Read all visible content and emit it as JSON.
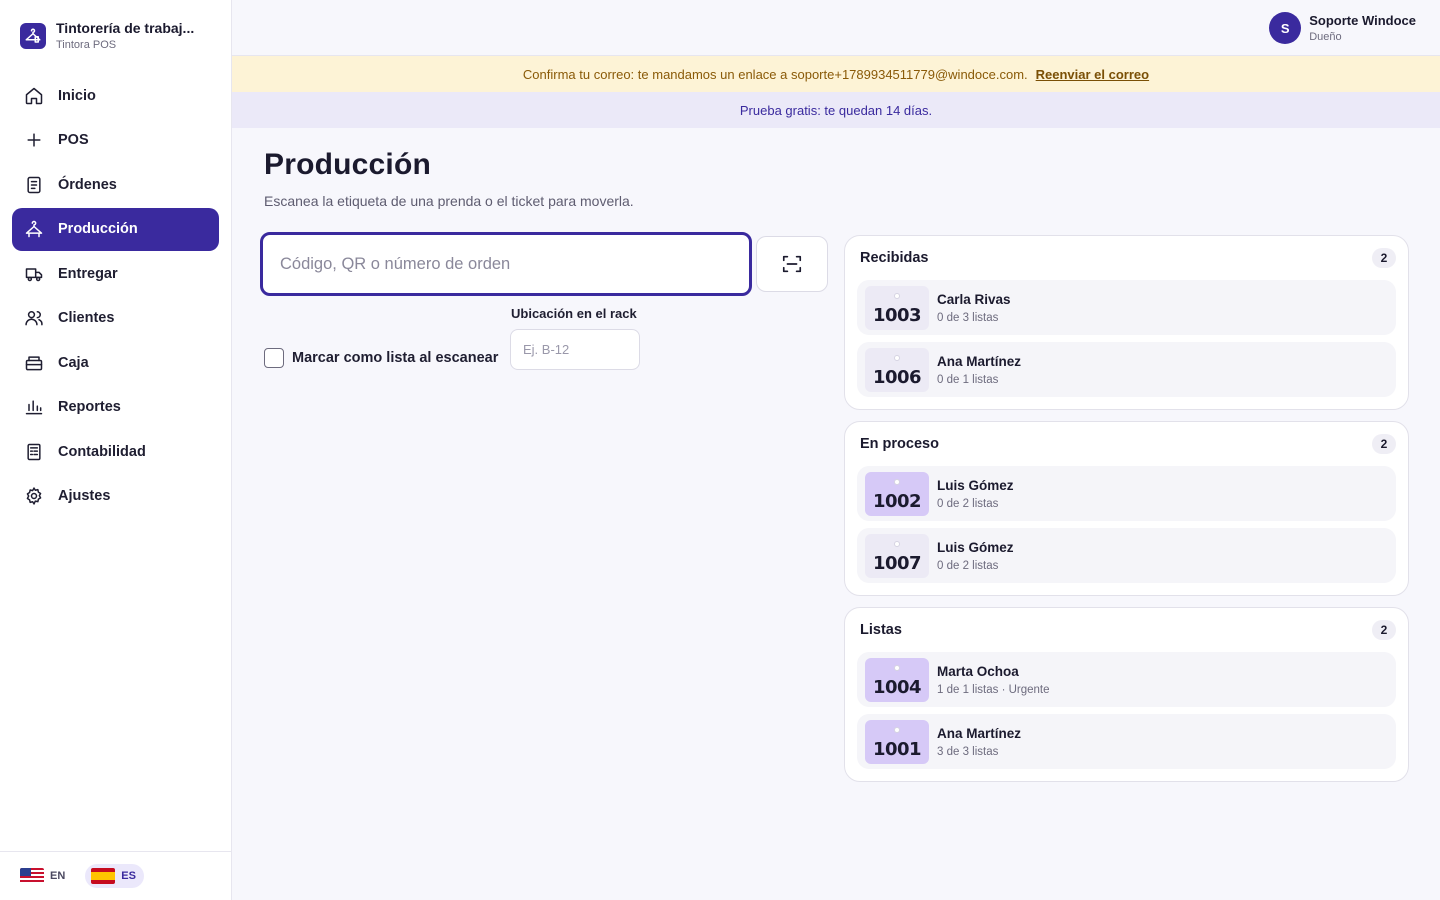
{
  "brand": {
    "title": "Tintorería de trabaj...",
    "subtitle": "Tintora POS"
  },
  "nav": [
    {
      "id": "inicio",
      "label": "Inicio",
      "icon": "home-icon"
    },
    {
      "id": "pos",
      "label": "POS",
      "icon": "plus-icon"
    },
    {
      "id": "ordenes",
      "label": "Órdenes",
      "icon": "document-icon"
    },
    {
      "id": "produccion",
      "label": "Producción",
      "icon": "hanger-icon",
      "active": true
    },
    {
      "id": "entregar",
      "label": "Entregar",
      "icon": "truck-icon"
    },
    {
      "id": "clientes",
      "label": "Clientes",
      "icon": "users-icon"
    },
    {
      "id": "caja",
      "label": "Caja",
      "icon": "register-icon"
    },
    {
      "id": "reportes",
      "label": "Reportes",
      "icon": "bar-chart-icon"
    },
    {
      "id": "contabilidad",
      "label": "Contabilidad",
      "icon": "ledger-icon"
    },
    {
      "id": "ajustes",
      "label": "Ajustes",
      "icon": "gear-icon"
    }
  ],
  "languages": [
    {
      "code": "EN",
      "flag": "us-flag-icon",
      "active": false
    },
    {
      "code": "ES",
      "flag": "spain-flag-icon",
      "active": true
    }
  ],
  "user": {
    "initial": "S",
    "name": "Soporte Windoce",
    "role": "Dueño"
  },
  "banners": {
    "email_text": "Confirma tu correo: te mandamos un enlace a soporte+1789934511779@windoce.com.",
    "email_link": "Reenviar el correo",
    "trial_text": "Prueba gratis: te quedan 14 días."
  },
  "page": {
    "title": "Producción",
    "subtitle": "Escanea la etiqueta de una prenda o el ticket para moverla.",
    "scan_placeholder": "Código, QR o número de orden",
    "mark_ready_label": "Marcar como lista al escanear",
    "rack_label": "Ubicación en el rack",
    "rack_placeholder": "Ej. B-12"
  },
  "columns": [
    {
      "title": "Recibidas",
      "count": "2",
      "orders": [
        {
          "number": "1003",
          "name": "Carla Rivas",
          "meta": "0 de 3 listas",
          "tag_color": "#eceaf5"
        },
        {
          "number": "1006",
          "name": "Ana Martínez",
          "meta": "0 de 1 listas",
          "tag_color": "#eceaf5"
        }
      ]
    },
    {
      "title": "En proceso",
      "count": "2",
      "orders": [
        {
          "number": "1002",
          "name": "Luis Gómez",
          "meta": "0 de 2 listas",
          "tag_color": "#d6c9f7"
        },
        {
          "number": "1007",
          "name": "Luis Gómez",
          "meta": "0 de 2 listas",
          "tag_color": "#eceaf5"
        }
      ]
    },
    {
      "title": "Listas",
      "count": "2",
      "orders": [
        {
          "number": "1004",
          "name": "Marta Ochoa",
          "meta": "1 de 1 listas · Urgente",
          "tag_color": "#d6c9f7"
        },
        {
          "number": "1001",
          "name": "Ana Martínez",
          "meta": "3 de 3 listas",
          "tag_color": "#d6c9f7"
        }
      ]
    }
  ],
  "colors": {
    "accent": "#3a2a9e",
    "warn_bg": "#fdf3d6",
    "trial_bg": "#ebe9f8"
  }
}
